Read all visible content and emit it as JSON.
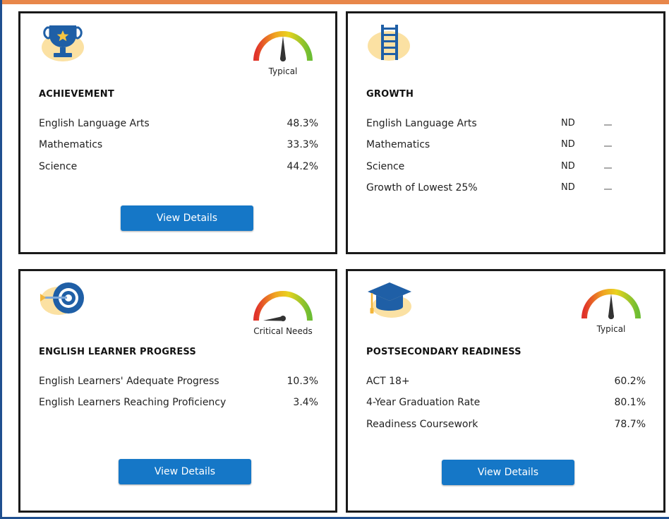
{
  "cards": {
    "achievement": {
      "title": "ACHIEVEMENT",
      "gauge_label": "Typical",
      "rows": [
        {
          "label": "English Language Arts",
          "value": "48.3%"
        },
        {
          "label": "Mathematics",
          "value": "33.3%"
        },
        {
          "label": "Science",
          "value": "44.2%"
        }
      ],
      "button": "View Details",
      "icon": "trophy-icon"
    },
    "growth": {
      "title": "GROWTH",
      "rows": [
        {
          "label": "English Language Arts",
          "value": "ND"
        },
        {
          "label": "Mathematics",
          "value": "ND"
        },
        {
          "label": "Science",
          "value": "ND"
        },
        {
          "label": "Growth of Lowest 25%",
          "value": "ND"
        }
      ],
      "icon": "ladder-icon"
    },
    "elp": {
      "title": "ENGLISH LEARNER PROGRESS",
      "gauge_label": "Critical Needs",
      "rows": [
        {
          "label": "English Learners' Adequate Progress",
          "value": "10.3%"
        },
        {
          "label": "English Learners Reaching Proficiency",
          "value": "3.4%"
        }
      ],
      "button": "View Details",
      "icon": "target-icon"
    },
    "postsecondary": {
      "title": "POSTSECONDARY READINESS",
      "gauge_label": "Typical",
      "rows": [
        {
          "label": "ACT 18+",
          "value": "60.2%"
        },
        {
          "label": "4-Year Graduation Rate",
          "value": "80.1%"
        },
        {
          "label": "Readiness Coursework",
          "value": "78.7%"
        }
      ],
      "button": "View Details",
      "icon": "graduation-cap-icon"
    }
  },
  "colors": {
    "button": "#1577c7",
    "icon_blue": "#1f5fa6",
    "icon_backdrop": "#fbe1a3",
    "accent_stripe": "#e8874a"
  }
}
